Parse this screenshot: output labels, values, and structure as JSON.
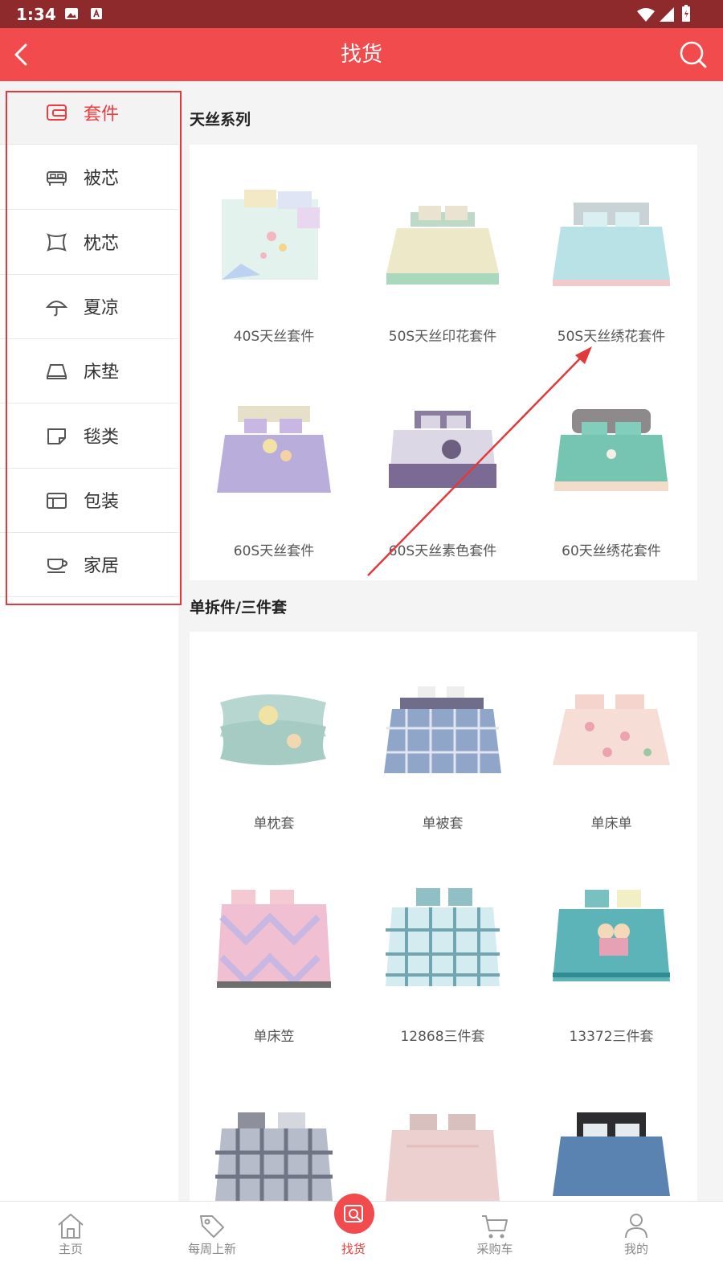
{
  "status_bar": {
    "time": "1:34"
  },
  "header": {
    "title": "找货"
  },
  "sidebar": {
    "items": [
      {
        "label": "套件",
        "icon": "wallet-icon",
        "active": true
      },
      {
        "label": "被芯",
        "icon": "bed-icon"
      },
      {
        "label": "枕芯",
        "icon": "pillow-icon"
      },
      {
        "label": "夏凉",
        "icon": "umbrella-icon"
      },
      {
        "label": "床垫",
        "icon": "mattress-icon"
      },
      {
        "label": "毯类",
        "icon": "blanket-icon"
      },
      {
        "label": "包装",
        "icon": "package-icon"
      },
      {
        "label": "家居",
        "icon": "cup-icon"
      }
    ]
  },
  "sections": [
    {
      "title": "天丝系列",
      "products": [
        {
          "label": "40S天丝套件"
        },
        {
          "label": "50S天丝印花套件"
        },
        {
          "label": "50S天丝绣花套件"
        },
        {
          "label": "60S天丝套件"
        },
        {
          "label": "60S天丝素色套件"
        },
        {
          "label": "60天丝绣花套件"
        }
      ]
    },
    {
      "title": "单拆件/三件套",
      "products": [
        {
          "label": "单枕套"
        },
        {
          "label": "单被套"
        },
        {
          "label": "单床单"
        },
        {
          "label": "单床笠"
        },
        {
          "label": "12868三件套"
        },
        {
          "label": "13372三件套"
        },
        {
          "label": ""
        },
        {
          "label": ""
        },
        {
          "label": ""
        }
      ]
    }
  ],
  "bottom_nav": {
    "items": [
      {
        "label": "主页",
        "icon": "home-icon"
      },
      {
        "label": "每周上新",
        "icon": "tag-icon"
      },
      {
        "label": "找货",
        "icon": "find-goods-icon",
        "active": true
      },
      {
        "label": "采购车",
        "icon": "cart-icon"
      },
      {
        "label": "我的",
        "icon": "user-icon"
      }
    ]
  },
  "colors": {
    "brand": "#f14b4d",
    "status_bar": "#8e2a2c",
    "active_text": "#ef3d3f",
    "annotation": "#e23a3c"
  }
}
